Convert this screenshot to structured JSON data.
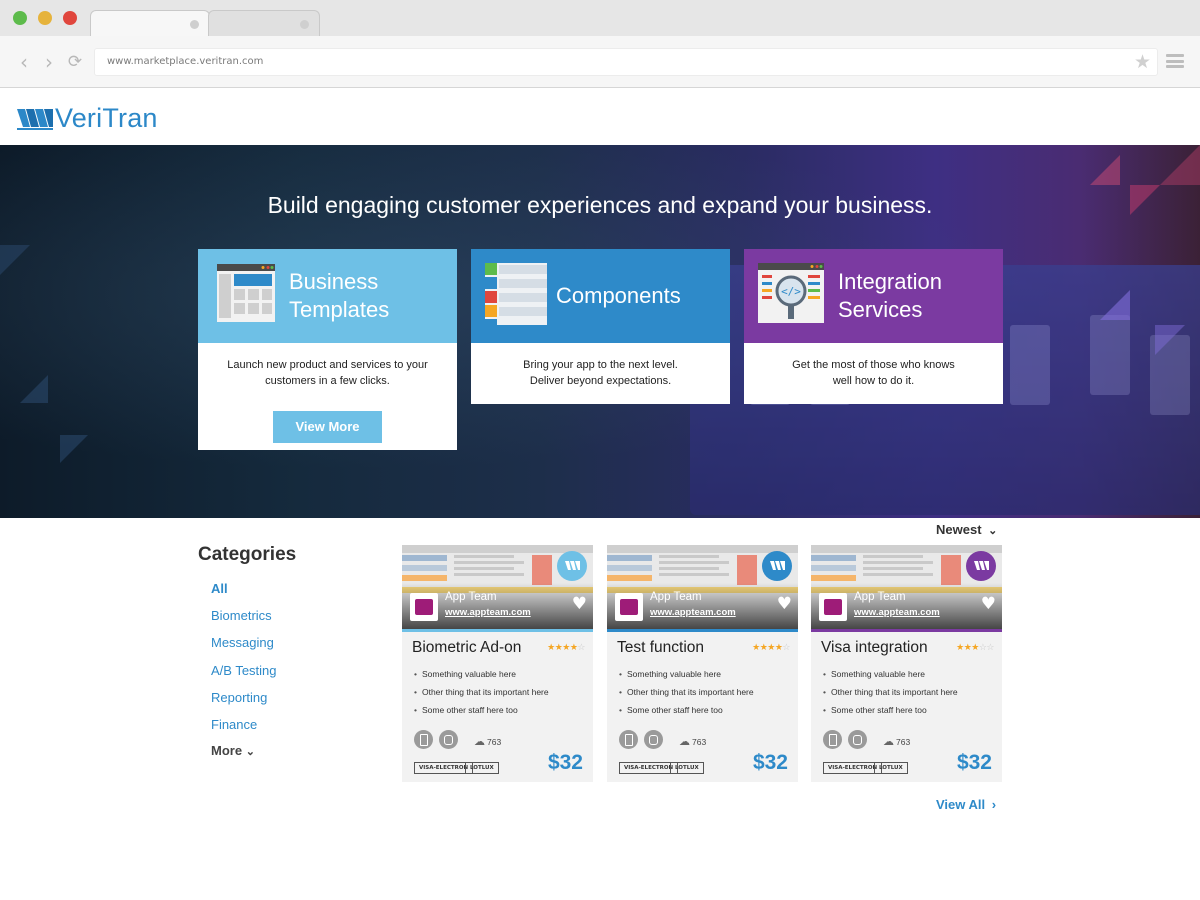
{
  "browser": {
    "url": "www.marketplace.veritran.com"
  },
  "brand": {
    "name": "VeriTran",
    "color": "#2c88c8"
  },
  "hero": {
    "headline": "Build engaging customer experiences and expand your business.",
    "cards": [
      {
        "title_line1": "Business",
        "title_line2": "Templates",
        "desc_line1": "Launch new product and services to your",
        "desc_line2": "customers in a few clicks.",
        "button": "View More",
        "color": "#6ec0e6",
        "icon": "template-icon"
      },
      {
        "title": "Components",
        "desc_line1": "Bring your app to the next level.",
        "desc_line2": "Deliver beyond expectations.",
        "color": "#2e8ac9",
        "icon": "components-icon"
      },
      {
        "title_line1": "Integration",
        "title_line2": "Services",
        "desc_line1": "Get the most of those who knows",
        "desc_line2": "well how to do it.",
        "color": "#7b3aa1",
        "icon": "code-search-icon"
      }
    ]
  },
  "categories": {
    "title": "Categories",
    "items": [
      "All",
      "Biometrics",
      "Messaging",
      "A/B Testing",
      "Reporting",
      "Finance"
    ],
    "more": "More"
  },
  "sort": {
    "label": "Newest"
  },
  "view_all": "View All",
  "products": [
    {
      "title": "Biometric Ad-on",
      "team": "App Team",
      "team_url": "www.appteam.com",
      "rating": 4,
      "bullets": [
        "Something valuable here",
        "Other thing that its important here",
        "Some other staff here too"
      ],
      "downloads": "763",
      "tags": [
        "VISA-ELECTRON",
        "LOTLUX"
      ],
      "price": "$32",
      "accent": "#6ec0e6"
    },
    {
      "title": "Test function",
      "team": "App Team",
      "team_url": "www.appteam.com",
      "rating": 4,
      "bullets": [
        "Something valuable here",
        "Other thing that its important here",
        "Some other staff here too"
      ],
      "downloads": "763",
      "tags": [
        "VISA-ELECTRON",
        "LOTLUX"
      ],
      "price": "$32",
      "accent": "#2e8ac9"
    },
    {
      "title": "Visa integration",
      "team": "App Team",
      "team_url": "www.appteam.com",
      "rating": 3,
      "bullets": [
        "Something valuable here",
        "Other thing that its important here",
        "Some other staff here too"
      ],
      "downloads": "763",
      "tags": [
        "VISA-ELECTRON",
        "LOTLUX"
      ],
      "price": "$32",
      "accent": "#7b3aa1"
    }
  ]
}
